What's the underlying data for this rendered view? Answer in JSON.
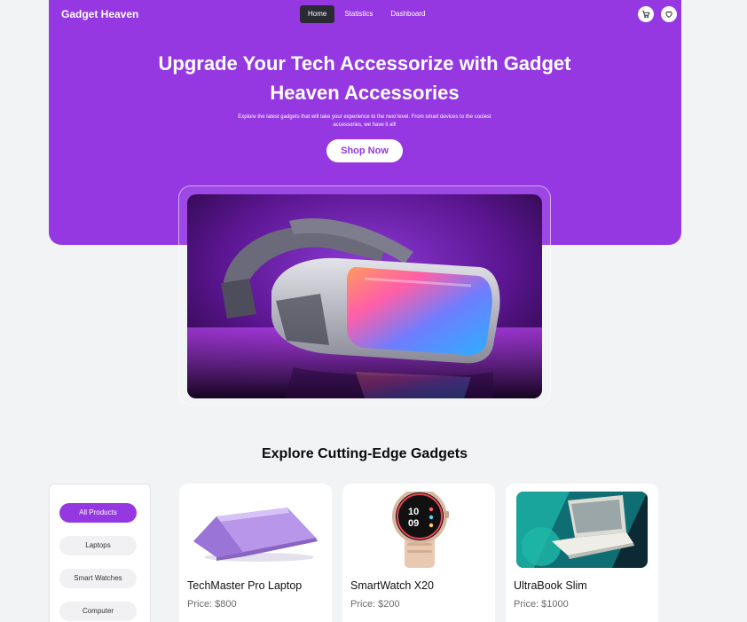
{
  "header": {
    "brand": "Gadget Heaven",
    "nav": [
      {
        "label": "Home"
      },
      {
        "label": "Statistics"
      },
      {
        "label": "Dashboard"
      }
    ],
    "icons": [
      "cart-icon",
      "heart-icon"
    ]
  },
  "hero": {
    "title": "Upgrade Your Tech Accessorize with Gadget Heaven Accessories",
    "subtitle": "Explore the latest gadgets that will take your experience to the next level. From smart devices to the coolest accessories, we have it all!",
    "cta": "Shop Now"
  },
  "section": {
    "title": "Explore Cutting-Edge Gadgets"
  },
  "categories": [
    {
      "label": "All Products",
      "active": true
    },
    {
      "label": "Laptops"
    },
    {
      "label": "Smart Watches"
    },
    {
      "label": "Computer"
    }
  ],
  "products": [
    {
      "name": "TechMaster Pro Laptop",
      "price": "Price: $800"
    },
    {
      "name": "SmartWatch X20",
      "price": "Price: $200"
    },
    {
      "name": "UltraBook Slim",
      "price": "Price: $1000"
    }
  ],
  "colors": {
    "accent": "#9538e2",
    "background": "#f2f3f5",
    "nav_active": "#2a2a35"
  }
}
